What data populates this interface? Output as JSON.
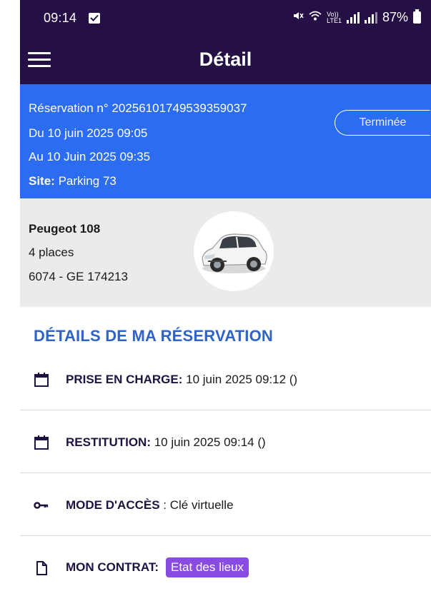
{
  "status_bar": {
    "time": "09:14",
    "battery": "87%",
    "network_label_top": "Vo))",
    "network_label_bottom": "LTE1",
    "signal_1": "R"
  },
  "app_bar": {
    "title": "Détail"
  },
  "reservation": {
    "number_line": "Réservation n° 20256101749539359037",
    "from_line": "Du 10 juin 2025 09:05",
    "to_line": "Au 10 Juin 2025 09:35",
    "site_label": "Site:",
    "site_value": "Parking 73",
    "status": "Terminée"
  },
  "vehicle": {
    "model": "Peugeot  108",
    "seats": "4  places",
    "plate": "6074 - GE 174213"
  },
  "details": {
    "heading": "DÉTAILS DE MA RÉSERVATION",
    "pickup_label": "PRISE EN CHARGE:",
    "pickup_value": " 10 juin 2025 09:12 ()",
    "return_label": "RESTITUTION:",
    "return_value": " 10 juin 2025 09:14 ()",
    "access_label": "MODE D'ACCÈS",
    "access_value": " : Clé virtuelle",
    "contract_label": "MON CONTRAT:",
    "contract_button": "Etat des lieux"
  },
  "colors": {
    "app_bar": "#241044",
    "banner": "#2c6cf0",
    "heading": "#2f63c6",
    "badge": "#8a4be3",
    "vehicle_bg": "#ebebeb"
  }
}
